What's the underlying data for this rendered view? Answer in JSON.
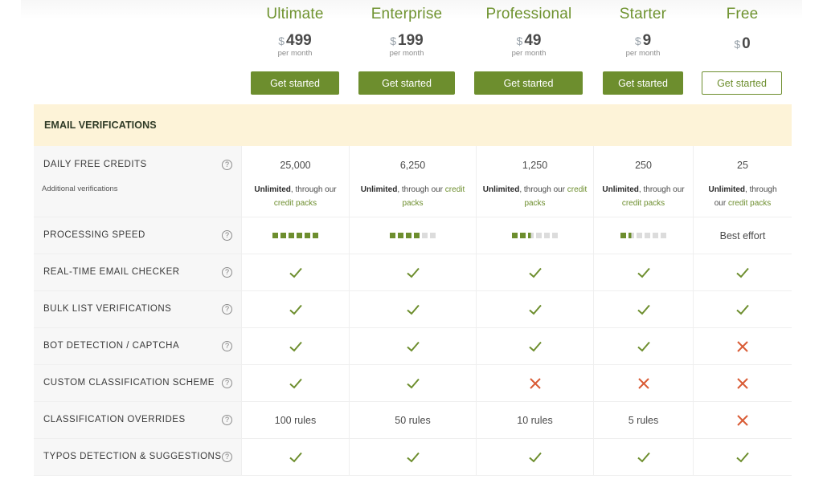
{
  "plans": [
    {
      "name": "Ultimate",
      "currency": "$",
      "price": "499",
      "period": "per month",
      "cta": "Get started",
      "style": "solid"
    },
    {
      "name": "Enterprise",
      "currency": "$",
      "price": "199",
      "period": "per month",
      "cta": "Get started",
      "style": "solid"
    },
    {
      "name": "Professional",
      "currency": "$",
      "price": "49",
      "period": "per month",
      "cta": "Get started",
      "style": "solid"
    },
    {
      "name": "Starter",
      "currency": "$",
      "price": "9",
      "period": "per month",
      "cta": "Get started",
      "style": "solid"
    },
    {
      "name": "Free",
      "currency": "$",
      "price": "0",
      "period": "",
      "cta": "Get started",
      "style": "outline"
    }
  ],
  "section": {
    "title": "EMAIL VERIFICATIONS"
  },
  "features": {
    "daily_free_credits": {
      "label": "DAILY FREE CREDITS",
      "sublabel": "Additional verifications",
      "values": [
        "25,000",
        "6,250",
        "1,250",
        "250",
        "25"
      ],
      "note_bold": "Unlimited",
      "note_text": ", through our ",
      "note_link": "credit packs"
    },
    "processing_speed": {
      "label": "PROCESSING SPEED",
      "max_level": 6,
      "levels": [
        6,
        4,
        2.5,
        1.5,
        null
      ],
      "text_values": [
        "",
        "",
        "",
        "",
        "Best effort"
      ]
    },
    "rows": [
      {
        "label": "REAL-TIME EMAIL CHECKER",
        "values": [
          "check",
          "check",
          "check",
          "check",
          "check"
        ]
      },
      {
        "label": "BULK LIST VERIFICATIONS",
        "values": [
          "check",
          "check",
          "check",
          "check",
          "check"
        ]
      },
      {
        "label": "BOT DETECTION / CAPTCHA",
        "values": [
          "check",
          "check",
          "check",
          "check",
          "cross"
        ]
      },
      {
        "label": "CUSTOM CLASSIFICATION SCHEME",
        "values": [
          "check",
          "check",
          "cross",
          "cross",
          "cross"
        ]
      },
      {
        "label": "CLASSIFICATION OVERRIDES",
        "values": [
          "100 rules",
          "50 rules",
          "10 rules",
          "5 rules",
          "cross"
        ]
      },
      {
        "label": "TYPOS DETECTION & SUGGESTIONS",
        "values": [
          "check",
          "check",
          "check",
          "check",
          "check"
        ]
      }
    ]
  },
  "icons": {
    "help": "?",
    "check": "check-icon",
    "cross": "cross-icon"
  },
  "colors": {
    "accent": "#6d8e2e",
    "cross": "#d95b35",
    "section_bg": "#fdf3d8"
  }
}
